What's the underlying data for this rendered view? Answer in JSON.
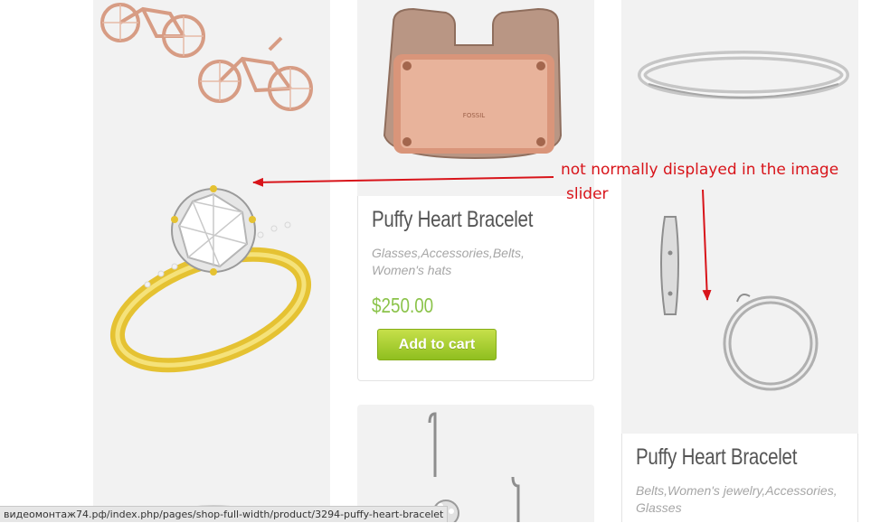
{
  "annotation": {
    "line1": "not normally displayed in the image",
    "line2": "slider",
    "color": "#d8141a"
  },
  "products": [
    {
      "title": "Puffy Heart Bracelet",
      "categories_line1": "Glasses,Accessories,Belts,",
      "categories_line2": "Women's hats",
      "price": "$250.00",
      "cart_label": "Add to cart"
    },
    {
      "title": "Puffy Heart Bracelet",
      "categories_line1": "Belts,Women's jewelry,Accessories,",
      "categories_line2": "Glasses"
    }
  ],
  "status_bar": {
    "url": "видеомонтаж74.рф/index.php/pages/shop-full-width/product/3294-puffy-heart-bracelet"
  },
  "icons": [
    "bicycle-earrings-image",
    "leather-cuff-image",
    "diamond-ring-image",
    "bangle-image",
    "hoop-earrings-image",
    "drop-earrings-image"
  ],
  "colors": {
    "price": "#8bc34a",
    "button": "#a6cc2a",
    "annotation": "#d8141a"
  }
}
